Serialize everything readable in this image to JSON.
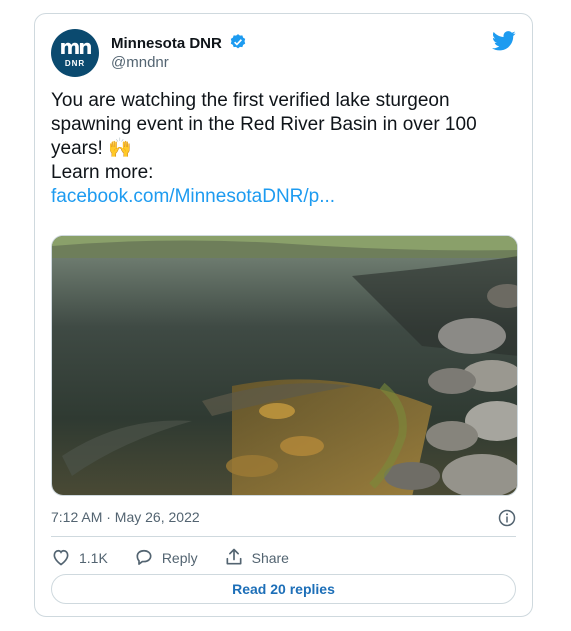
{
  "author": {
    "name": "Minnesota DNR",
    "handle": "@mndnr",
    "avatar_text": "mn",
    "avatar_subtext": "DNR"
  },
  "tweet": {
    "lines": [
      "You are watching the first verified lake sturgeon",
      "spawning event in the Red River Basin in over 100",
      "years! 🙌",
      "",
      "Learn more:"
    ],
    "link": "facebook.com/MinnesotaDNR/p..."
  },
  "timestamp": "7:12 AM · May 26, 2022",
  "actions": {
    "likes": "1.1K",
    "reply": "Reply",
    "share": "Share"
  },
  "read_replies": "Read 20 replies",
  "colors": {
    "accent": "#1d9bf0",
    "text": "#0f1419",
    "muted": "#536471",
    "border": "#cfd9de"
  },
  "icons": [
    "verified-badge-icon",
    "twitter-bird-icon",
    "info-icon",
    "heart-icon",
    "reply-icon",
    "share-icon"
  ]
}
